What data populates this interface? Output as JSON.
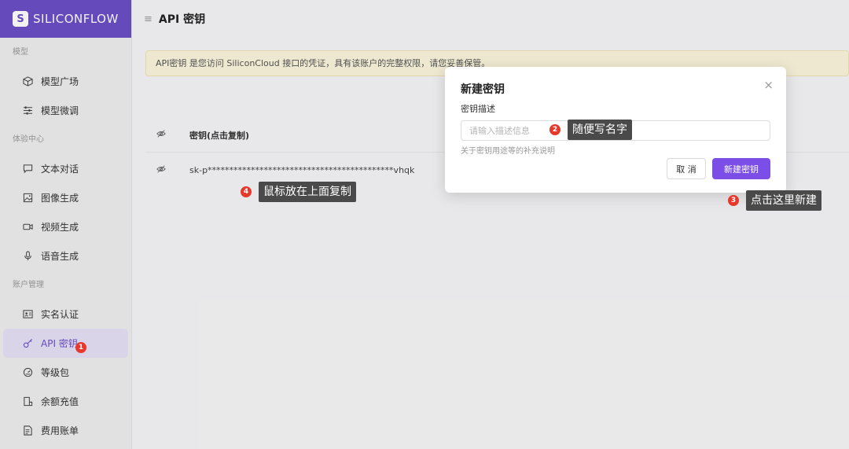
{
  "brand": {
    "logo_mark": "S",
    "name": "SILICONFLOW"
  },
  "sidebar": {
    "sections": [
      {
        "label": "模型",
        "items": [
          {
            "label": "模型广场",
            "icon": "cube-icon"
          },
          {
            "label": "模型微调",
            "icon": "sliders-icon"
          }
        ]
      },
      {
        "label": "体验中心",
        "items": [
          {
            "label": "文本对话",
            "icon": "chat-icon"
          },
          {
            "label": "图像生成",
            "icon": "image-icon"
          },
          {
            "label": "视频生成",
            "icon": "video-icon"
          },
          {
            "label": "语音生成",
            "icon": "mic-icon"
          }
        ]
      },
      {
        "label": "账户管理",
        "items": [
          {
            "label": "实名认证",
            "icon": "id-card-icon"
          },
          {
            "label": "API 密钥",
            "icon": "key-icon",
            "active": true
          },
          {
            "label": "等级包",
            "icon": "gauge-icon"
          },
          {
            "label": "余额充值",
            "icon": "wallet-icon"
          },
          {
            "label": "费用账单",
            "icon": "bill-icon"
          }
        ]
      }
    ]
  },
  "header": {
    "title": "API 密钥"
  },
  "notice": {
    "text": "API密钥 是您访问 SiliconCloud 接口的凭证，具有该账户的完整权限，请您妥善保管。"
  },
  "table": {
    "header_key": "密钥(点击复制)",
    "rows": [
      {
        "key": "sk-p*******************************************vhqk"
      }
    ]
  },
  "modal": {
    "title": "新建密钥",
    "close_glyph": "×",
    "field_label": "密钥描述",
    "field_placeholder": "请输入描述信息",
    "field_value": "",
    "field_help": "关于密钥用途等的补充说明",
    "cancel_label": "取 消",
    "create_label": "新建密钥"
  },
  "annotations": [
    {
      "number": "1",
      "text": ""
    },
    {
      "number": "2",
      "text": "随便写名字"
    },
    {
      "number": "3",
      "text": "点击这里新建"
    },
    {
      "number": "4",
      "text": "鼠标放在上面复制"
    }
  ],
  "colors": {
    "brand": "#6b4fc6",
    "primary_button": "#7b4ee8",
    "badge": "#e8372b",
    "notice_bg": "#fbf5dc"
  }
}
